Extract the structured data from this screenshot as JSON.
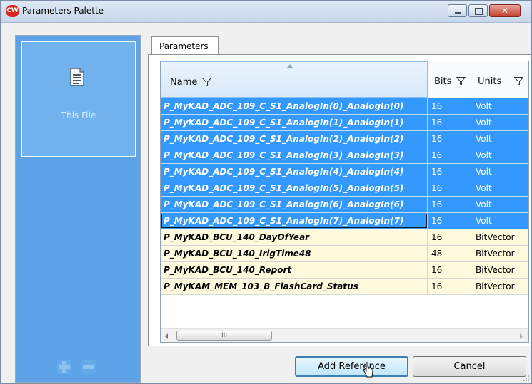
{
  "window": {
    "app_icon_text": "CW",
    "title": "Parameters Palette",
    "close_glyph": "✕"
  },
  "left_panel": {
    "item_label": "This File",
    "icons": [
      "document-icon",
      "plus-icon",
      "minus-icon"
    ]
  },
  "tabs": [
    {
      "label": "Parameters"
    }
  ],
  "table": {
    "columns": [
      {
        "label": "Name"
      },
      {
        "label": "Bits"
      },
      {
        "label": "Units"
      }
    ],
    "rows": [
      {
        "name": "P_MyKAD_ADC_109_C_S1_AnalogIn(0)_AnalogIn(0)",
        "bits": "16",
        "units": "Volt",
        "selected": true
      },
      {
        "name": "P_MyKAD_ADC_109_C_S1_AnalogIn(1)_AnalogIn(1)",
        "bits": "16",
        "units": "Volt",
        "selected": true
      },
      {
        "name": "P_MyKAD_ADC_109_C_S1_AnalogIn(2)_AnalogIn(2)",
        "bits": "16",
        "units": "Volt",
        "selected": true
      },
      {
        "name": "P_MyKAD_ADC_109_C_S1_AnalogIn(3)_AnalogIn(3)",
        "bits": "16",
        "units": "Volt",
        "selected": true
      },
      {
        "name": "P_MyKAD_ADC_109_C_S1_AnalogIn(4)_AnalogIn(4)",
        "bits": "16",
        "units": "Volt",
        "selected": true
      },
      {
        "name": "P_MyKAD_ADC_109_C_S1_AnalogIn(5)_AnalogIn(5)",
        "bits": "16",
        "units": "Volt",
        "selected": true
      },
      {
        "name": "P_MyKAD_ADC_109_C_S1_AnalogIn(6)_AnalogIn(6)",
        "bits": "16",
        "units": "Volt",
        "selected": true
      },
      {
        "name": "P_MyKAD_ADC_109_C_S1_AnalogIn(7)_AnalogIn(7)",
        "bits": "16",
        "units": "Volt",
        "selected": true,
        "focused": true
      },
      {
        "name": "P_MyKAD_BCU_140_DayOfYear",
        "bits": "16",
        "units": "BitVector",
        "selected": false
      },
      {
        "name": "P_MyKAD_BCU_140_IrigTime48",
        "bits": "48",
        "units": "BitVector",
        "selected": false
      },
      {
        "name": "P_MyKAD_BCU_140_Report",
        "bits": "16",
        "units": "BitVector",
        "selected": false
      },
      {
        "name": "P_MyKAM_MEM_103_B_FlashCard_Status",
        "bits": "16",
        "units": "BitVector",
        "selected": false
      }
    ],
    "scrollbar_thumb": "III"
  },
  "buttons": {
    "add_reference": "Add Reference",
    "cancel": "Cancel"
  },
  "colors": {
    "selection": "#3399ff",
    "unselected_row": "#fff9dd",
    "left_panel": "#5ba3e6"
  }
}
